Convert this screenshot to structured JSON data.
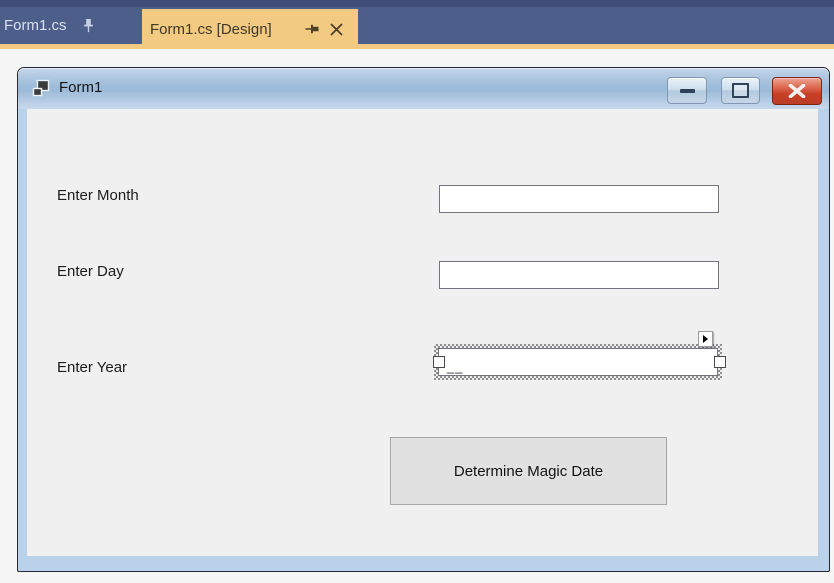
{
  "tab_bar": {
    "tabs": [
      {
        "label": "Form1.cs",
        "state": "inactive",
        "pin_icon": "pushpin-icon"
      },
      {
        "label": "Form1.cs [Design]",
        "state": "active",
        "pin_icon": "pushpin-icon",
        "close_icon": "close-icon"
      }
    ]
  },
  "designer": {
    "window_title": "Form1",
    "titlebar_icons": {
      "form_icon": "winform-window-icon",
      "minimize": "minimize-icon",
      "maximize": "maximize-icon",
      "close": "close-icon"
    },
    "rows": [
      {
        "label": "Enter Month",
        "value": "",
        "state": "normal"
      },
      {
        "label": "Enter Day",
        "value": "",
        "state": "normal"
      },
      {
        "label": "Enter Year",
        "value": "__",
        "state": "selected"
      }
    ],
    "selected_control": {
      "smart_tag_icon": "smart-tag-arrow-icon",
      "handles": [
        "left",
        "right"
      ]
    },
    "action_button": "Determine Magic Date"
  },
  "colors": {
    "tab_bar_bg": "#4d5e8b",
    "tab_bar_top": "#3d4d76",
    "active_tab_bg": "#f3ca81",
    "inactive_tab_text": "#d9e0ef",
    "active_tab_text": "#3f3a2d",
    "window_border_blue": "#b9d1e9",
    "titlebar_gradient_top": "#c3d5e9",
    "titlebar_gradient_bottom": "#c9d9ec",
    "close_button_red": "#c73e26",
    "client_bg": "#f0f0f0",
    "textbox_border": "#72767c",
    "button_bg": "#e1e1e1",
    "page_bg": "#f5f5f5"
  }
}
